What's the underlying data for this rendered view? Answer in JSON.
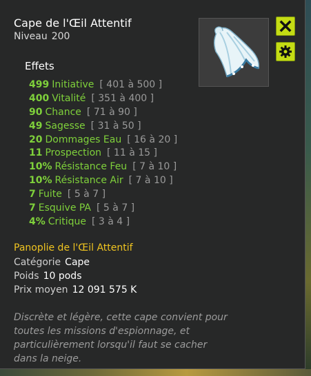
{
  "item": {
    "name": "Cape de l'Œil Attentif",
    "level_label": "Niveau",
    "level": "200"
  },
  "effects_title": "Effets",
  "effects": [
    {
      "value": "499",
      "stat": "Initiative",
      "range": "[ 401 à 500 ]"
    },
    {
      "value": "400",
      "stat": "Vitalité",
      "range": "[ 351 à 400 ]"
    },
    {
      "value": "90",
      "stat": "Chance",
      "range": "[ 71 à 90 ]"
    },
    {
      "value": "49",
      "stat": "Sagesse",
      "range": "[ 31 à 50 ]"
    },
    {
      "value": "20",
      "stat": "Dommages Eau",
      "range": "[ 16 à 20 ]"
    },
    {
      "value": "11",
      "stat": "Prospection",
      "range": "[ 11 à 15 ]"
    },
    {
      "value": "10%",
      "stat": "Résistance Feu",
      "range": "[ 7 à 10 ]"
    },
    {
      "value": "10%",
      "stat": "Résistance Air",
      "range": "[ 7 à 10 ]"
    },
    {
      "value": "7",
      "stat": "Fuite",
      "range": "[ 5 à 7 ]"
    },
    {
      "value": "7",
      "stat": "Esquive PA",
      "range": "[ 5 à 7 ]"
    },
    {
      "value": "4%",
      "stat": "Critique",
      "range": "[ 3 à 4 ]"
    }
  ],
  "set_name": "Panoplie de l'Œil Attentif",
  "category": {
    "label": "Catégorie",
    "value": "Cape"
  },
  "weight": {
    "label": "Poids",
    "value": "10 pods"
  },
  "price": {
    "label": "Prix moyen",
    "value": "12 091 575 K"
  },
  "description": [
    "Discrète et légère, cette cape convient pour",
    "toutes les missions d'espionnage, et",
    "particulièrement lorsqu'il faut se cacher",
    "dans la neige."
  ],
  "icons": {
    "close": "close-icon",
    "settings": "gear-icon",
    "item": "cape-icon"
  },
  "colors": {
    "bonus_text": "#7fd13b",
    "set_text": "#f0c420",
    "button_bg": "#c4dc14",
    "panel_bg": "#282828"
  }
}
